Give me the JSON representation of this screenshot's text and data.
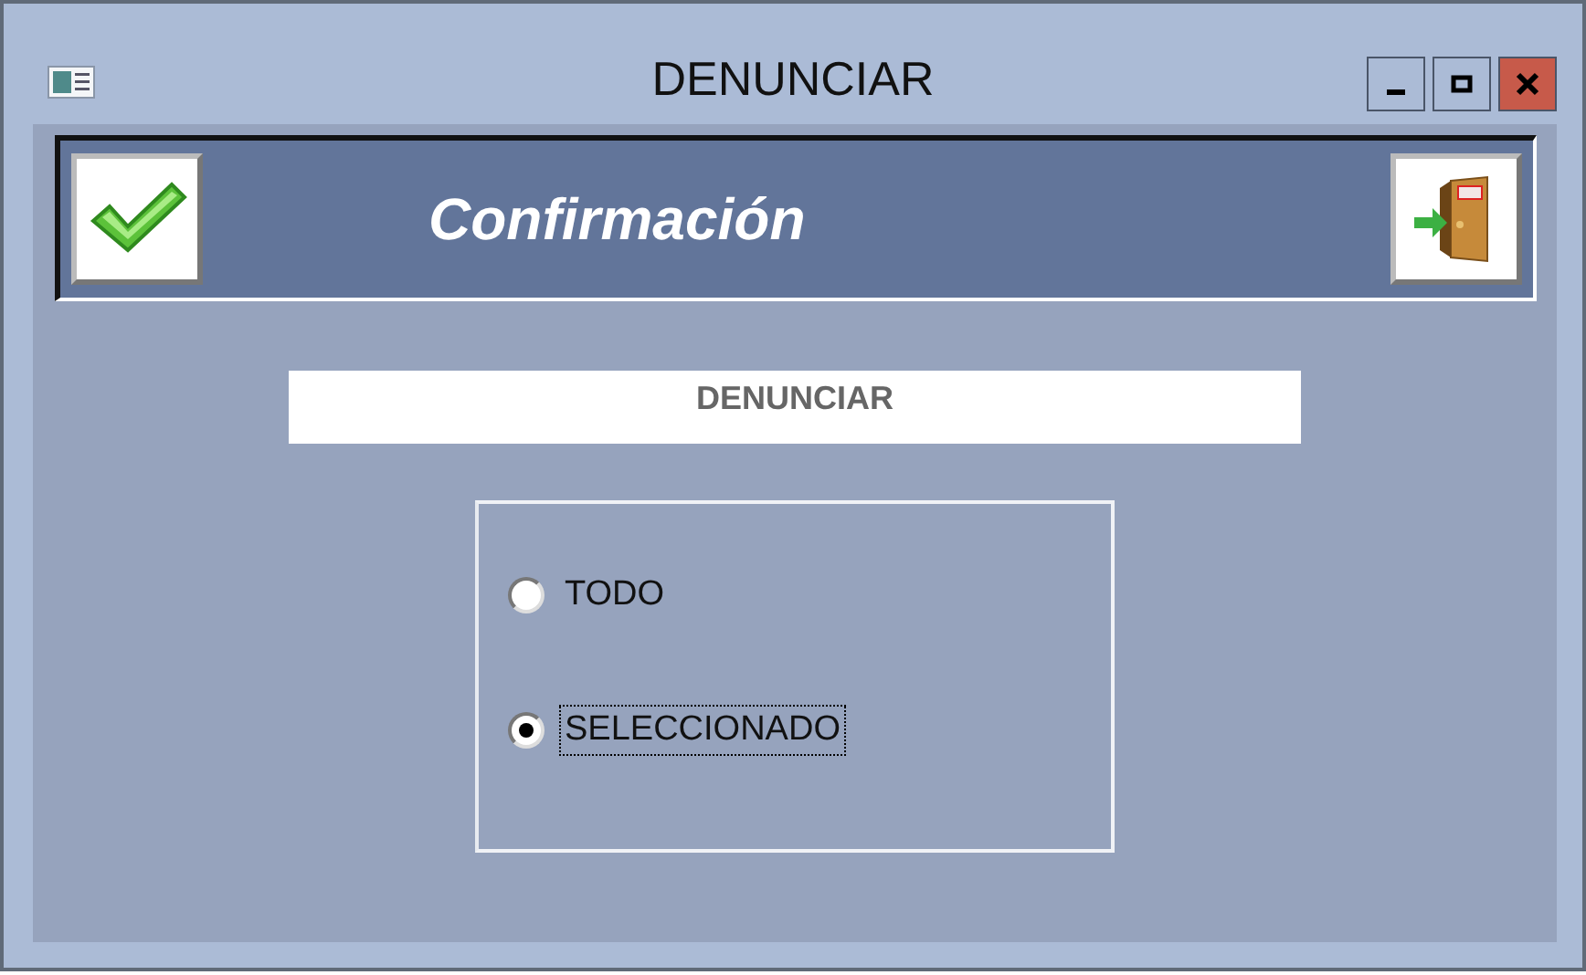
{
  "window": {
    "title": "DENUNCIAR"
  },
  "header": {
    "title": "Confirmación"
  },
  "field": {
    "value": "DENUNCIAR"
  },
  "options": [
    {
      "label": "TODO",
      "selected": false,
      "focused": false
    },
    {
      "label": "SELECCIONADO",
      "selected": true,
      "focused": true
    }
  ]
}
